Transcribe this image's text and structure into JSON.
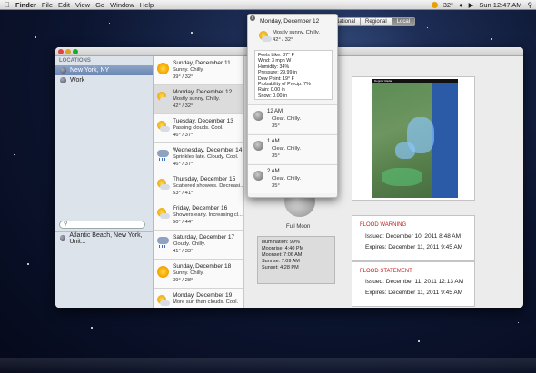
{
  "menubar": {
    "apple": "",
    "app": "Finder",
    "items": [
      "File",
      "Edit",
      "View",
      "Go",
      "Window",
      "Help"
    ],
    "temp": "32°",
    "clock": "Sun 12:47 AM"
  },
  "sidebar": {
    "header": "LOCATIONS",
    "locations": [
      "New York, NY",
      "Work"
    ],
    "search_placeholder": "",
    "recent": "Atlantic Beach, New York, Unit..."
  },
  "days": [
    {
      "title": "Sunday, December 11",
      "desc": "Sunny. Chilly.",
      "temps": "39° / 32°",
      "icon": "sun-icon"
    },
    {
      "title": "Monday, December 12",
      "desc": "Mostly sunny. Chilly.",
      "temps": "42° / 32°",
      "icon": "sun-cloud-icon"
    },
    {
      "title": "Tuesday, December 13",
      "desc": "Passing clouds. Cool.",
      "temps": "46° / 37°",
      "icon": "sun-cloud-icon"
    },
    {
      "title": "Wednesday, December 14",
      "desc": "Sprinkles late. Cloudy. Cool.",
      "temps": "46° / 37°",
      "icon": "rain-icon"
    },
    {
      "title": "Thursday, December 15",
      "desc": "Scattered showers. Decreasi...",
      "temps": "53° / 41°",
      "icon": "sun-cloud-icon"
    },
    {
      "title": "Friday, December 16",
      "desc": "Showers early. Increasing cl...",
      "temps": "50° / 44°",
      "icon": "sun-cloud-icon"
    },
    {
      "title": "Saturday, December 17",
      "desc": "Cloudy. Chilly.",
      "temps": "41° / 33°",
      "icon": "rain-icon"
    },
    {
      "title": "Sunday, December 18",
      "desc": "Sunny. Chilly.",
      "temps": "39° / 28°",
      "icon": "sun-icon"
    },
    {
      "title": "Monday, December 19",
      "desc": "More sun than clouds. Cool.",
      "temps": "",
      "icon": "sun-cloud-icon"
    }
  ],
  "popover": {
    "title": "Monday, December 12",
    "desc": "Mostly sunny. Chilly.",
    "temps": "42° / 32°",
    "details": [
      "Feels Like: 37° F",
      "Wind: 3 mph W",
      "Humidity: 34%",
      "Pressure: 29.99 in",
      "Dew Point: 19° F",
      "Probability of Precip: 7%",
      "Rain: 0.00 in",
      "Snow: 0.00 in"
    ],
    "hours": [
      {
        "time": "12 AM",
        "cond": "Clear. Chilly.",
        "temp": "35°"
      },
      {
        "time": "1 AM",
        "cond": "Clear. Chilly.",
        "temp": "35°"
      },
      {
        "time": "2 AM",
        "cond": "Clear. Chilly.",
        "temp": "35°"
      }
    ]
  },
  "segments": [
    "National",
    "Regional",
    "Local"
  ],
  "radar_title": "Doppler Radar",
  "moon": {
    "phase": "Full Moon",
    "stats": [
      "Illumination: 99%",
      "Moonrise: 4:40 PM",
      "Moonset: 7:06 AM",
      "Sunrise: 7:09 AM",
      "Sunset: 4:28 PM"
    ]
  },
  "alerts": [
    {
      "title": "FLOOD WARNING",
      "issued": "Issued: December 10, 2011 8:48 AM",
      "expires": "Expires: December 11, 2011 9:45 AM"
    },
    {
      "title": "FLOOD STATEMENT",
      "issued": "Issued: December 11, 2011 12:13 AM",
      "expires": "Expires: December 11, 2011 9:45 AM"
    }
  ]
}
